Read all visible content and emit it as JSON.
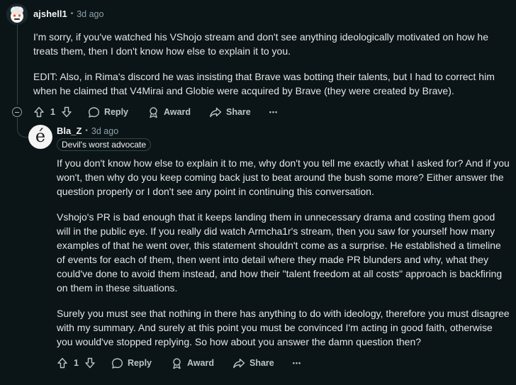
{
  "comment": {
    "username": "ajshell1",
    "separator": "•",
    "time": "3d ago",
    "paragraphs": [
      "I'm sorry, if you've watched his VShojo stream and don't see anything ideologically motivated on how he treats them, then I don't know how else to explain it to you.",
      "EDIT: Also, in Rima's discord he was insisting that Brave was botting their talents, but I had to correct him when he claimed that V4Mirai and Globie were acquired by Brave (they were created by Brave)."
    ],
    "actions": {
      "votes": "1",
      "reply": "Reply",
      "award": "Award",
      "share": "Share",
      "more": "•••"
    }
  },
  "reply": {
    "username": "Bla_Z",
    "separator": "•",
    "time": "3d ago",
    "flair": "Devil's worst advocate",
    "avatar_glyph": "é",
    "paragraphs": [
      "If you don't know how else to explain it to me, why don't you tell me exactly what I asked for? And if you won't, then why do you keep coming back just to beat around the bush some more? Either answer the question properly or I don't see any point in continuing this conversation.",
      "Vshojo's PR is bad enough that it keeps landing them in unnecessary drama and costing them good will in the public eye. If you really did watch Armcha1r's stream, then you saw for yourself how many examples of that he went over, this statement shouldn't come as a surprise. He established a timeline of events for each of them, then went into detail where they made PR blunders and why, what they could've done to avoid them instead, and how their \"talent freedom at all costs\" approach is backfiring on them in these situations.",
      "Surely you must see that nothing in there has anything to do with ideology, therefore you must disagree with my summary. And surely at this point you must be convinced I'm acting in good faith, otherwise you would've stopped replying. So how about you answer the damn question then?"
    ],
    "actions": {
      "votes": "1",
      "reply": "Reply",
      "award": "Award",
      "share": "Share",
      "more": "•••"
    }
  },
  "icons": [
    "upvote-icon",
    "downvote-icon",
    "reply-icon",
    "award-icon",
    "share-icon",
    "more-icon",
    "collapse-icon"
  ],
  "colors": {
    "background": "#0b1416",
    "text": "#e3e6e8",
    "muted": "#8ba2ad",
    "thread_line": "#33464c"
  }
}
